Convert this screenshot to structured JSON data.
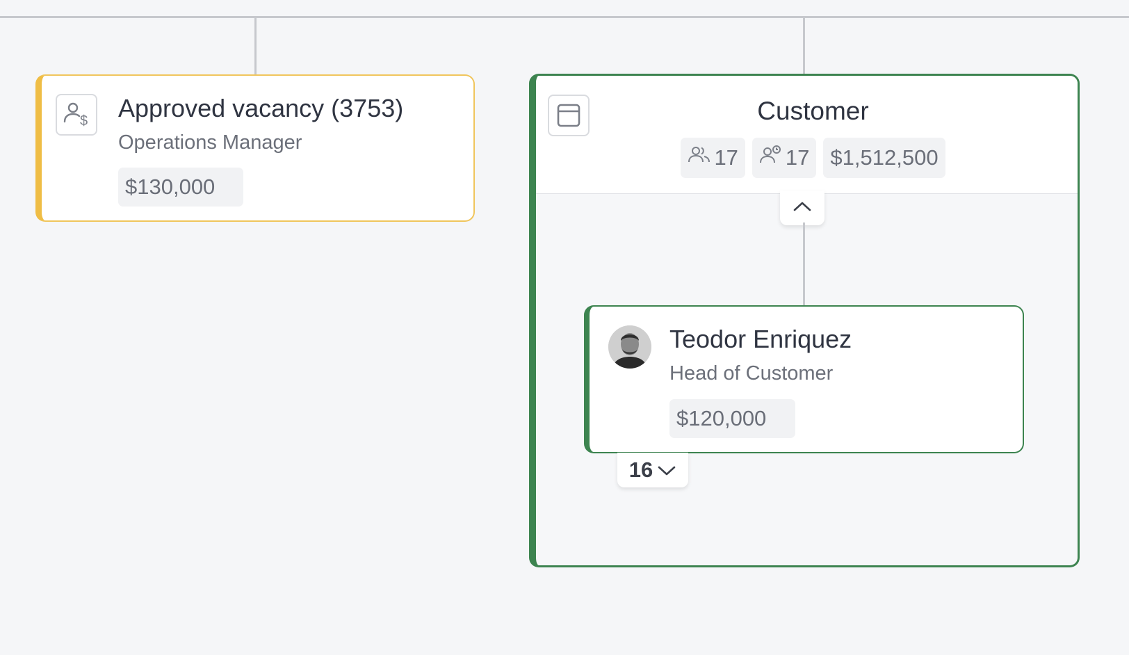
{
  "vacancy": {
    "title": "Approved vacancy (3753)",
    "subtitle": "Operations Manager",
    "salary": "$130,000",
    "icon": "person-dollar-icon",
    "accent": "#efbd45"
  },
  "department": {
    "name": "Customer",
    "icon": "department-frame-icon",
    "accent": "#3d8450",
    "stats": {
      "headcount": "17",
      "headcount_icon": "people-icon",
      "filled": "17",
      "filled_icon": "person-clock-icon",
      "budget": "$1,512,500"
    },
    "collapse_icon": "chevron-up-icon"
  },
  "employee": {
    "name": "Teodor Enriquez",
    "role": "Head of Customer",
    "salary": "$120,000",
    "avatar": "avatar-photo",
    "reports_count": "16",
    "expand_icon": "chevron-down-icon"
  },
  "colors": {
    "background": "#f5f6f8",
    "connector": "#c6c8cd",
    "vacancy_border": "#f0c55c",
    "department_border": "#3d8450"
  }
}
